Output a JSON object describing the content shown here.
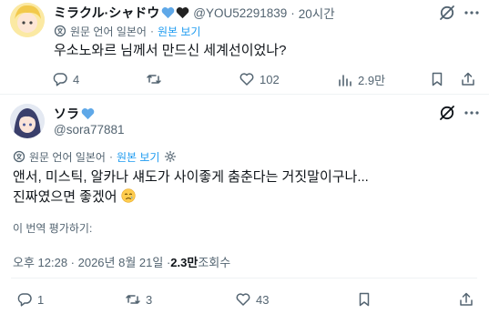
{
  "reply": {
    "display_name": "ミラクル·シャドウ",
    "handle": "@YOU52291839",
    "dot": "·",
    "time": "20시간",
    "translate_note": "원문 언어 일본어",
    "show_original": "원본 보기",
    "text": "우소노와르 님께서 만드신 세계선이었나?",
    "stats": {
      "replies": "4",
      "likes": "102",
      "views": "2.9만"
    }
  },
  "main": {
    "display_name": "ソラ",
    "handle": "@sora77881",
    "translate_note": "원문 언어 일본어",
    "show_original": "원본 보기",
    "text_line1": "앤서, 미스틱, 알카나 섀도가 사이좋게 춤춘다는 거짓말이구나...",
    "text_line2": "진짜였으면 좋겠어",
    "rate_translation": "이 번역 평가하기:",
    "timestamp": "오후 12:28 · 2026년 8월 21일 · ",
    "views_count": "2.3만",
    "views_label": " 조회수",
    "stats": {
      "replies": "1",
      "reposts": "3",
      "likes": "43"
    }
  },
  "colors": {
    "accent": "#1d9bf0",
    "heart_blue": "#5fa8e8",
    "muted": "#536471"
  },
  "icons": [
    "translate-icon",
    "gear-icon",
    "grok-icon",
    "more-icon",
    "reply-icon",
    "repost-icon",
    "like-icon",
    "views-icon",
    "bookmark-icon",
    "share-icon"
  ]
}
